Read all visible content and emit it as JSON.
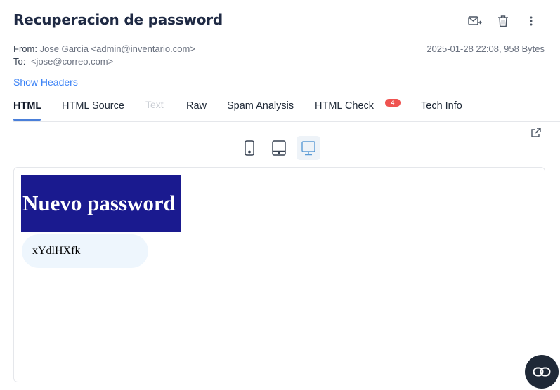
{
  "header": {
    "title": "Recuperacion de password",
    "actions": [
      "forward-icon",
      "trash-icon",
      "more-vertical-icon"
    ]
  },
  "meta": {
    "from_label": "From:",
    "from_value": "Jose Garcia <admin@inventario.com>",
    "to_label": "To:",
    "to_value": "<jose@correo.com>",
    "date_size": "2025-01-28 22:08, 958 Bytes",
    "show_headers": "Show Headers"
  },
  "tabs": [
    {
      "label": "HTML",
      "active": true
    },
    {
      "label": "HTML Source"
    },
    {
      "label": "Text",
      "disabled": true
    },
    {
      "label": "Raw"
    },
    {
      "label": "Spam Analysis"
    },
    {
      "label": "HTML Check",
      "badge": "4"
    },
    {
      "label": "Tech Info"
    }
  ],
  "device_toggles": [
    "phone-icon",
    "tablet-icon",
    "desktop-icon"
  ],
  "active_device": "desktop",
  "email_body": {
    "heading": "Nuevo password",
    "password": "xYdlHXfk",
    "heading_bg": "#1a1a8f",
    "password_bg": "#eef6fd"
  },
  "colors": {
    "accent": "#4a7fd9",
    "link": "#3b82f6",
    "badge": "#ef5350"
  }
}
